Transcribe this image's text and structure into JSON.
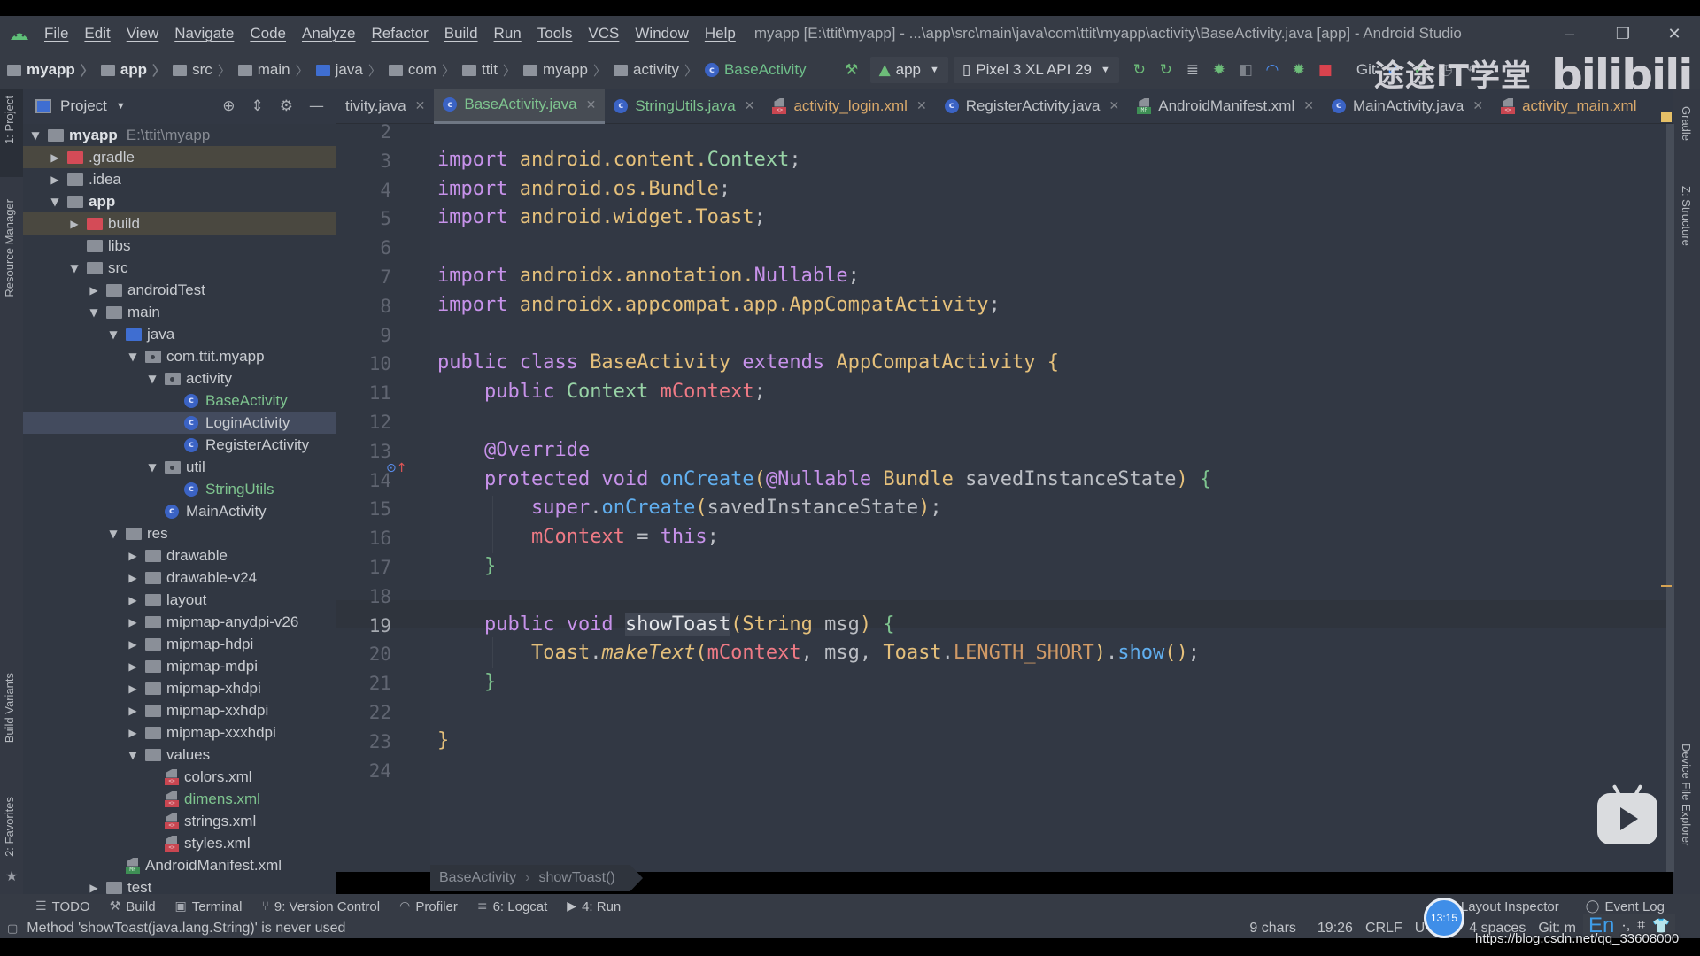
{
  "window": {
    "title": "myapp [E:\\ttit\\myapp] - ...\\app\\src\\main\\java\\com\\ttit\\myapp\\activity\\BaseActivity.java [app] - Android Studio",
    "controls": {
      "minimize": "–",
      "restore": "❐",
      "close": "✕"
    }
  },
  "menu": [
    "File",
    "Edit",
    "View",
    "Navigate",
    "Code",
    "Analyze",
    "Refactor",
    "Build",
    "Run",
    "Tools",
    "VCS",
    "Window",
    "Help"
  ],
  "breadcrumbs": [
    "myapp",
    "app",
    "src",
    "main",
    "java",
    "com",
    "ttit",
    "myapp",
    "activity",
    "BaseActivity"
  ],
  "toolbar": {
    "run_config": "app",
    "device": "Pixel 3 XL API 29",
    "git_label": "Git:"
  },
  "editor_tabs": [
    {
      "label": "tivity.java",
      "type": "java",
      "active": false
    },
    {
      "label": "BaseActivity.java",
      "type": "java",
      "active": true
    },
    {
      "label": "StringUtils.java",
      "type": "java",
      "active": false
    },
    {
      "label": "activity_login.xml",
      "type": "xml",
      "active": false
    },
    {
      "label": "RegisterActivity.java",
      "type": "java",
      "active": false
    },
    {
      "label": "AndroidManifest.xml",
      "type": "manifest",
      "active": false
    },
    {
      "label": "MainActivity.java",
      "type": "java",
      "active": false
    },
    {
      "label": "activity_main.xml",
      "type": "xml",
      "active": false
    }
  ],
  "project_panel": {
    "title": "Project",
    "tree": [
      {
        "label": "myapp",
        "extra": "E:\\ttit\\myapp",
        "depth": 0,
        "arrow": "▼",
        "kind": "module-root",
        "bold": true
      },
      {
        "label": ".gradle",
        "depth": 1,
        "arrow": "▶",
        "kind": "excluded",
        "highlight": "orange"
      },
      {
        "label": ".idea",
        "depth": 1,
        "arrow": "▶",
        "kind": "folder"
      },
      {
        "label": "app",
        "depth": 1,
        "arrow": "▼",
        "kind": "module",
        "bold": true
      },
      {
        "label": "build",
        "depth": 2,
        "arrow": "▶",
        "kind": "excluded",
        "highlight": "orange"
      },
      {
        "label": "libs",
        "depth": 2,
        "arrow": "",
        "kind": "folder"
      },
      {
        "label": "src",
        "depth": 2,
        "arrow": "▼",
        "kind": "folder"
      },
      {
        "label": "androidTest",
        "depth": 3,
        "arrow": "▶",
        "kind": "folder"
      },
      {
        "label": "main",
        "depth": 3,
        "arrow": "▼",
        "kind": "folder"
      },
      {
        "label": "java",
        "depth": 4,
        "arrow": "▼",
        "kind": "source"
      },
      {
        "label": "com.ttit.myapp",
        "depth": 5,
        "arrow": "▼",
        "kind": "package"
      },
      {
        "label": "activity",
        "depth": 6,
        "arrow": "▼",
        "kind": "package"
      },
      {
        "label": "BaseActivity",
        "depth": 7,
        "arrow": "",
        "kind": "class",
        "color": "green"
      },
      {
        "label": "LoginActivity",
        "depth": 7,
        "arrow": "",
        "kind": "class",
        "selected": true
      },
      {
        "label": "RegisterActivity",
        "depth": 7,
        "arrow": "",
        "kind": "class"
      },
      {
        "label": "util",
        "depth": 6,
        "arrow": "▼",
        "kind": "package"
      },
      {
        "label": "StringUtils",
        "depth": 7,
        "arrow": "",
        "kind": "class",
        "color": "green"
      },
      {
        "label": "MainActivity",
        "depth": 6,
        "arrow": "",
        "kind": "class"
      },
      {
        "label": "res",
        "depth": 4,
        "arrow": "▼",
        "kind": "resources"
      },
      {
        "label": "drawable",
        "depth": 5,
        "arrow": "▶",
        "kind": "folder"
      },
      {
        "label": "drawable-v24",
        "depth": 5,
        "arrow": "▶",
        "kind": "folder"
      },
      {
        "label": "layout",
        "depth": 5,
        "arrow": "▶",
        "kind": "folder"
      },
      {
        "label": "mipmap-anydpi-v26",
        "depth": 5,
        "arrow": "▶",
        "kind": "folder"
      },
      {
        "label": "mipmap-hdpi",
        "depth": 5,
        "arrow": "▶",
        "kind": "folder"
      },
      {
        "label": "mipmap-mdpi",
        "depth": 5,
        "arrow": "▶",
        "kind": "folder"
      },
      {
        "label": "mipmap-xhdpi",
        "depth": 5,
        "arrow": "▶",
        "kind": "folder"
      },
      {
        "label": "mipmap-xxhdpi",
        "depth": 5,
        "arrow": "▶",
        "kind": "folder"
      },
      {
        "label": "mipmap-xxxhdpi",
        "depth": 5,
        "arrow": "▶",
        "kind": "folder"
      },
      {
        "label": "values",
        "depth": 5,
        "arrow": "▼",
        "kind": "folder"
      },
      {
        "label": "colors.xml",
        "depth": 6,
        "arrow": "",
        "kind": "xml"
      },
      {
        "label": "dimens.xml",
        "depth": 6,
        "arrow": "",
        "kind": "xml",
        "color": "green"
      },
      {
        "label": "strings.xml",
        "depth": 6,
        "arrow": "",
        "kind": "xml"
      },
      {
        "label": "styles.xml",
        "depth": 6,
        "arrow": "",
        "kind": "xml"
      },
      {
        "label": "AndroidManifest.xml",
        "depth": 4,
        "arrow": "",
        "kind": "manifest"
      },
      {
        "label": "test",
        "depth": 3,
        "arrow": "▶",
        "kind": "folder"
      }
    ]
  },
  "left_strip": [
    "1: Project",
    "Resource Manager",
    "Build Variants",
    "2: Favorites"
  ],
  "right_strip": [
    "Gradle",
    "Z: Structure",
    "Device File Explorer"
  ],
  "code": {
    "current_line": 19,
    "lines": [
      {
        "n": 2,
        "tokens": []
      },
      {
        "n": 3,
        "tokens": [
          [
            "kw",
            "import "
          ],
          [
            "pkg",
            "android.content."
          ],
          [
            "tyg",
            "Context"
          ],
          [
            "plain",
            ";"
          ]
        ]
      },
      {
        "n": 4,
        "tokens": [
          [
            "kw",
            "import "
          ],
          [
            "pkg",
            "android.os.Bundle"
          ],
          [
            "plain",
            ";"
          ]
        ]
      },
      {
        "n": 5,
        "tokens": [
          [
            "kw",
            "import "
          ],
          [
            "pkg",
            "android.widget.Toast"
          ],
          [
            "plain",
            ";"
          ]
        ]
      },
      {
        "n": 6,
        "tokens": []
      },
      {
        "n": 7,
        "tokens": [
          [
            "kw",
            "import "
          ],
          [
            "pkg",
            "androidx.annotation."
          ],
          [
            "kw",
            "Nullable"
          ],
          [
            "plain",
            ";"
          ]
        ]
      },
      {
        "n": 8,
        "tokens": [
          [
            "kw",
            "import "
          ],
          [
            "pkg",
            "androidx.appcompat.app.AppCompatActivity"
          ],
          [
            "plain",
            ";"
          ]
        ]
      },
      {
        "n": 9,
        "tokens": []
      },
      {
        "n": 10,
        "tokens": [
          [
            "kw",
            "public class "
          ],
          [
            "ty",
            "BaseActivity "
          ],
          [
            "kw",
            "extends "
          ],
          [
            "ty",
            "AppCompatActivity "
          ],
          [
            "br",
            "{"
          ]
        ]
      },
      {
        "n": 11,
        "tokens": [
          [
            "plain",
            "    "
          ],
          [
            "kw",
            "public "
          ],
          [
            "tyg",
            "Context "
          ],
          [
            "fld",
            "mContext"
          ],
          [
            "plain",
            ";"
          ]
        ]
      },
      {
        "n": 12,
        "tokens": []
      },
      {
        "n": 13,
        "tokens": [
          [
            "plain",
            "    "
          ],
          [
            "ann",
            "@Override"
          ]
        ]
      },
      {
        "n": 14,
        "tokens": [
          [
            "plain",
            "    "
          ],
          [
            "kw",
            "protected void "
          ],
          [
            "fn",
            "onCreate"
          ],
          [
            "br",
            "("
          ],
          [
            "ann",
            "@Nullable "
          ],
          [
            "ty",
            "Bundle "
          ],
          [
            "plain",
            "savedInstanceState"
          ],
          [
            "br",
            ")"
          ],
          [
            "plain",
            " "
          ],
          [
            "brg",
            "{"
          ]
        ]
      },
      {
        "n": 15,
        "tokens": [
          [
            "plain",
            "        "
          ],
          [
            "kw",
            "super"
          ],
          [
            "plain",
            "."
          ],
          [
            "fn",
            "onCreate"
          ],
          [
            "br",
            "("
          ],
          [
            "plain",
            "savedInstanceState"
          ],
          [
            "br",
            ")"
          ],
          [
            "plain",
            ";"
          ]
        ]
      },
      {
        "n": 16,
        "tokens": [
          [
            "plain",
            "        "
          ],
          [
            "fld",
            "mContext "
          ],
          [
            "plain",
            "= "
          ],
          [
            "kw",
            "this"
          ],
          [
            "plain",
            ";"
          ]
        ]
      },
      {
        "n": 17,
        "tokens": [
          [
            "plain",
            "    "
          ],
          [
            "brg",
            "}"
          ]
        ]
      },
      {
        "n": 18,
        "tokens": []
      },
      {
        "n": 19,
        "tokens": [
          [
            "plain",
            "    "
          ],
          [
            "kw",
            "public void "
          ],
          [
            "sel",
            "showToast"
          ],
          [
            "br",
            "("
          ],
          [
            "ty",
            "String "
          ],
          [
            "plain",
            "msg"
          ],
          [
            "br",
            ")"
          ],
          [
            "plain",
            " "
          ],
          [
            "brg",
            "{"
          ]
        ]
      },
      {
        "n": 20,
        "tokens": [
          [
            "plain",
            "        "
          ],
          [
            "ty",
            "Toast"
          ],
          [
            "plain",
            "."
          ],
          [
            "it",
            "makeText"
          ],
          [
            "br",
            "("
          ],
          [
            "fld",
            "mContext"
          ],
          [
            "plain",
            ", msg, "
          ],
          [
            "ty",
            "Toast"
          ],
          [
            "plain",
            "."
          ],
          [
            "const",
            "LENGTH_SHORT"
          ],
          [
            "br",
            ")"
          ],
          [
            "plain",
            "."
          ],
          [
            "fn",
            "show"
          ],
          [
            "br",
            "()"
          ],
          [
            "plain",
            ";"
          ]
        ]
      },
      {
        "n": 21,
        "tokens": [
          [
            "plain",
            "    "
          ],
          [
            "brg",
            "}"
          ]
        ]
      },
      {
        "n": 22,
        "tokens": []
      },
      {
        "n": 23,
        "tokens": [
          [
            "br",
            "}"
          ]
        ]
      },
      {
        "n": 24,
        "tokens": []
      }
    ]
  },
  "editor_breadcrumb": [
    "BaseActivity",
    "showToast()"
  ],
  "tool_windows": [
    {
      "icon": "☰",
      "label": "TODO"
    },
    {
      "icon": "⚒",
      "label": "Build"
    },
    {
      "icon": "▣",
      "label": "Terminal"
    },
    {
      "icon": "⑂",
      "label": "9: Version Control"
    },
    {
      "icon": "◠",
      "label": "Profiler"
    },
    {
      "icon": "≡",
      "label": "6: Logcat"
    },
    {
      "icon": "▶",
      "label": "4: Run"
    }
  ],
  "tool_windows_right": [
    {
      "label": "Layout Inspector"
    },
    {
      "icon": "◯",
      "label": "Event Log"
    }
  ],
  "status": {
    "message": "Method 'showToast(java.lang.String)' is never used",
    "chars": "9 chars",
    "position": "19:26",
    "line_sep": "CRLF",
    "encoding": "U",
    "indent": "4 spaces",
    "git": "Git: m"
  },
  "overlay": {
    "watermark_cn": "途途IT学堂",
    "watermark_brand": "bilibili",
    "clock": "13:15",
    "ime": "En",
    "url": "https://blog.csdn.net/qq_33608000"
  }
}
